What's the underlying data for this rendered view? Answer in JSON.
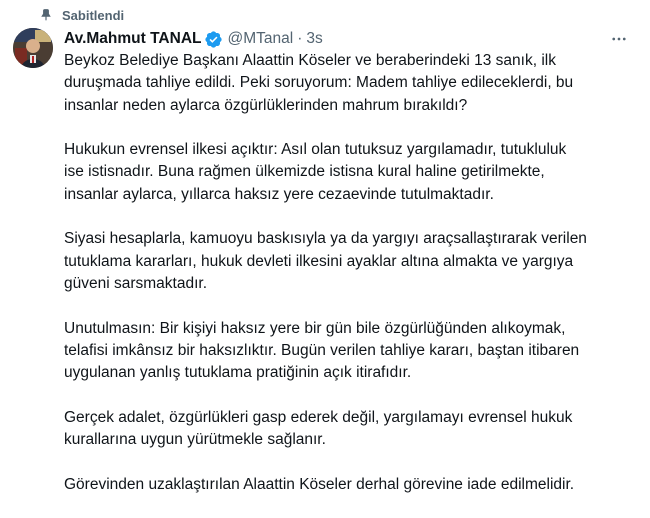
{
  "pinned": {
    "label": "Sabitlendi",
    "icon": "pin-icon"
  },
  "author": {
    "display_name": "Av.Mahmut TANAL",
    "handle": "@MTanal",
    "separator": "·",
    "time": "3s",
    "verified_icon": "verified-badge-icon",
    "verified_color": "#1d9bf0"
  },
  "more_icon": "more-horizontal-icon",
  "paragraphs": [
    "Beykoz Belediye Başkanı Alaattin Köseler ve beraberindeki 13 sanık, ilk\nduruşmada tahliye edildi. Peki soruyorum: Madem tahliye edileceklerdi, bu\ninsanlar neden aylarca özgürlüklerinden mahrum bırakıldı?",
    "Hukukun evrensel ilkesi açıktır: Asıl olan tutuksuz yargılamadır, tutukluluk\nise istisnadır. Buna rağmen ülkemizde istisna kural haline getirilmekte,\ninsanlar aylarca, yıllarca haksız yere cezaevinde tutulmaktadır.",
    "Siyasi hesaplarla, kamuoyu baskısıyla ya da yargıyı araçsallaştırarak verilen\ntutuklama kararları, hukuk devleti ilkesini ayaklar altına almakta ve yargıya\ngüveni sarsmaktadır.",
    "Unutulmasın: Bir kişiyi haksız yere bir gün bile özgürlüğünden alıkoymak,\ntelafisi imkânsız bir haksızlıktır. Bugün verilen tahliye kararı, baştan itibaren\nuygulanan yanlış tutuklama pratiğinin açık itirafıdır.",
    "Gerçek adalet, özgürlükleri gasp ederek değil, yargılamayı evrensel hukuk\nkurallarına uygun yürütmekle sağlanır.",
    "Görevinden uzaklaştırılan Alaattin Köseler derhal görevine iade edilmelidir."
  ]
}
